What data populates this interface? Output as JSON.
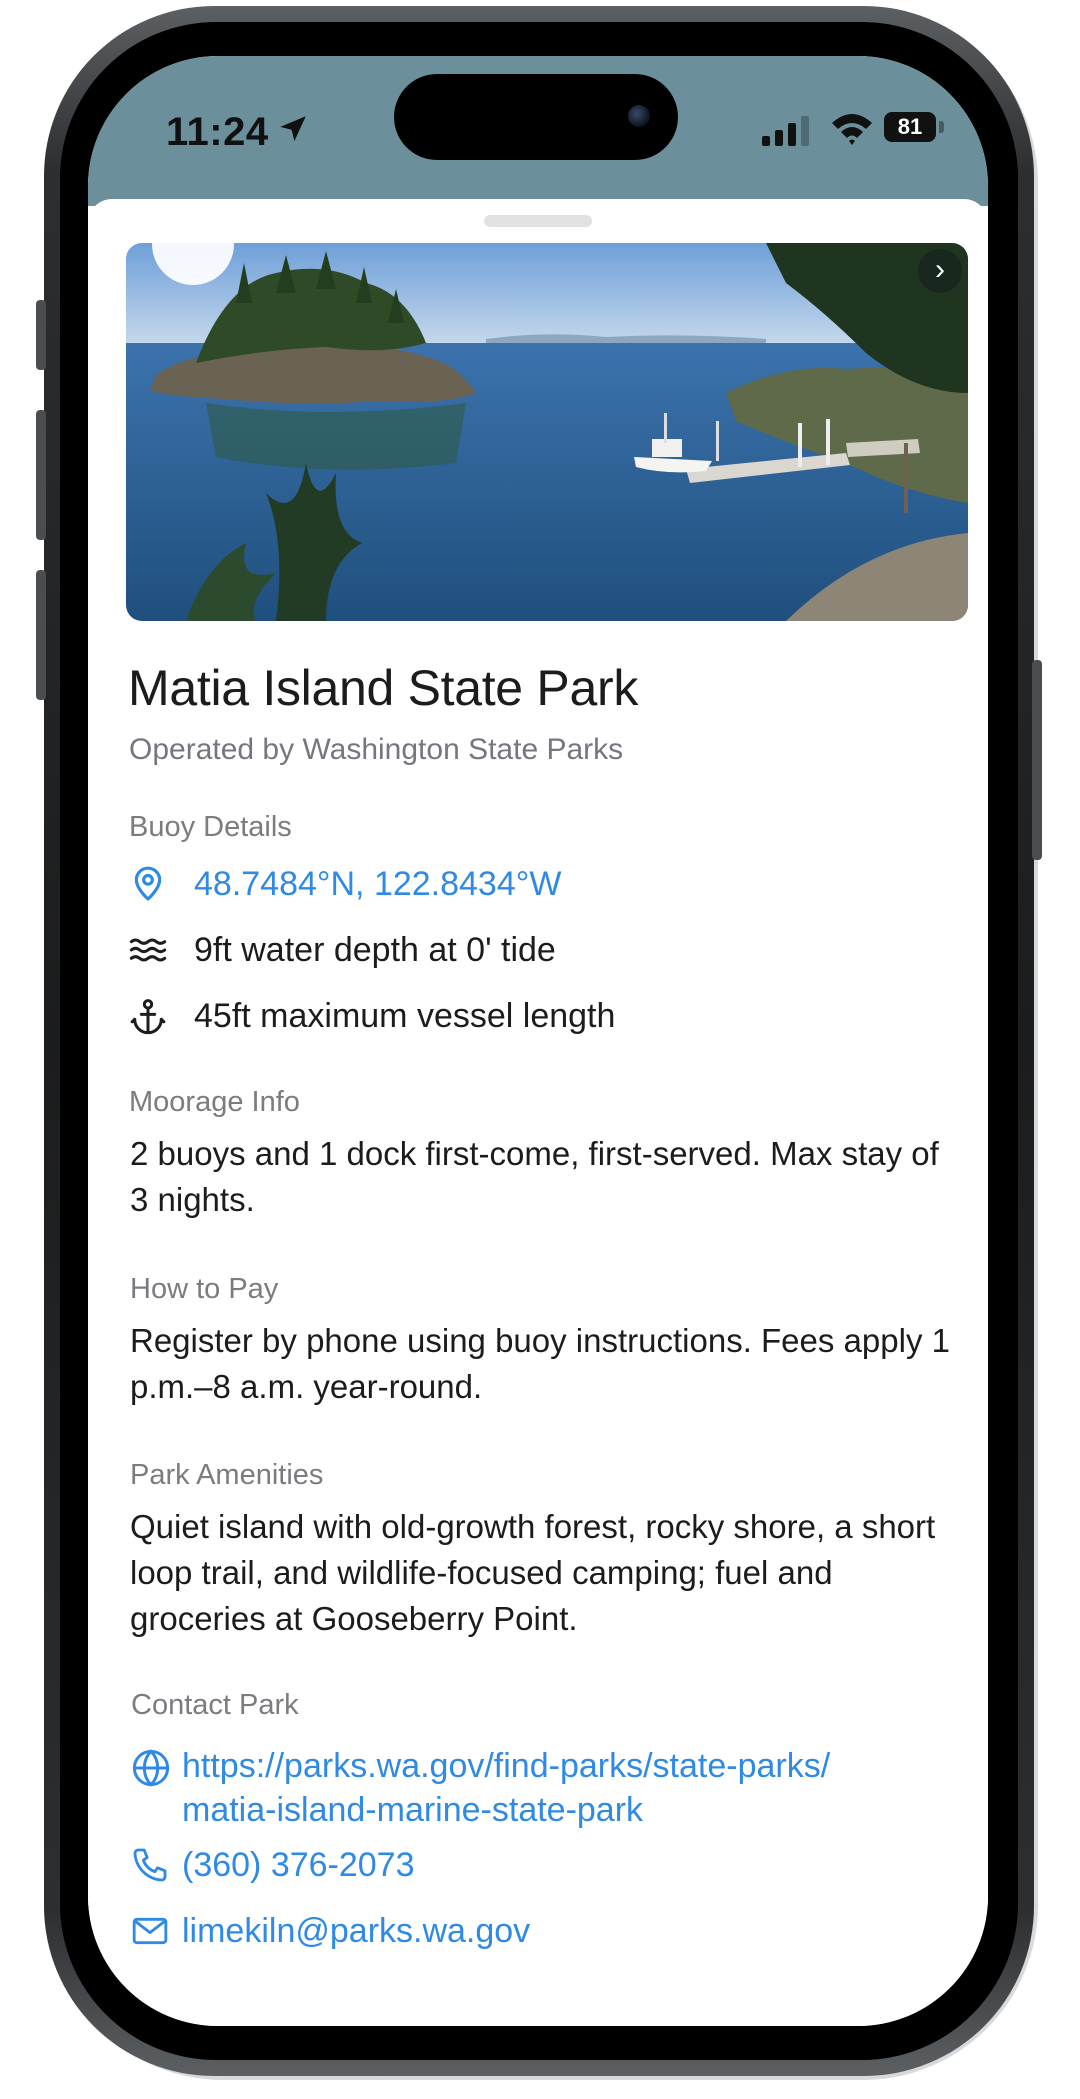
{
  "status_bar": {
    "time": "11:24",
    "battery": "81"
  },
  "park": {
    "name": "Matia Island State Park",
    "operator": "Operated by Washington State Parks"
  },
  "buoy_details": {
    "label": "Buoy Details",
    "coordinates": "48.7484°N, 122.8434°W",
    "depth": "9ft water depth at 0' tide",
    "max_length": "45ft maximum vessel length"
  },
  "moorage": {
    "label": "Moorage Info",
    "text": "2 buoys and 1 dock first-come, first-served. Max stay of 3 nights."
  },
  "pay": {
    "label": "How to Pay",
    "text": "Register by phone using buoy instructions. Fees apply 1 p.m.–8 a.m. year-round."
  },
  "amenities": {
    "label": "Park Amenities",
    "text": "Quiet island with old-growth forest, rocky shore, a short loop trail, and wildlife-focused camping; fuel and groceries at Gooseberry Point."
  },
  "contact": {
    "label": "Contact Park",
    "website_line1": "https://parks.wa.gov/find-parks/state-parks/",
    "website_line2": "matia-island-marine-state-park",
    "phone": "(360) 376-2073",
    "email": "limekiln@parks.wa.gov"
  },
  "icons": {
    "location": "map-pin-icon",
    "depth": "waves-icon",
    "length": "anchor-icon",
    "website": "globe-icon",
    "phone": "phone-icon",
    "email": "mail-icon",
    "next_photo": "chevron-right-icon"
  },
  "colors": {
    "accent": "#2f8ae5",
    "header": "#6b909b",
    "label": "#7b7b80",
    "text": "#1c1c1e"
  }
}
